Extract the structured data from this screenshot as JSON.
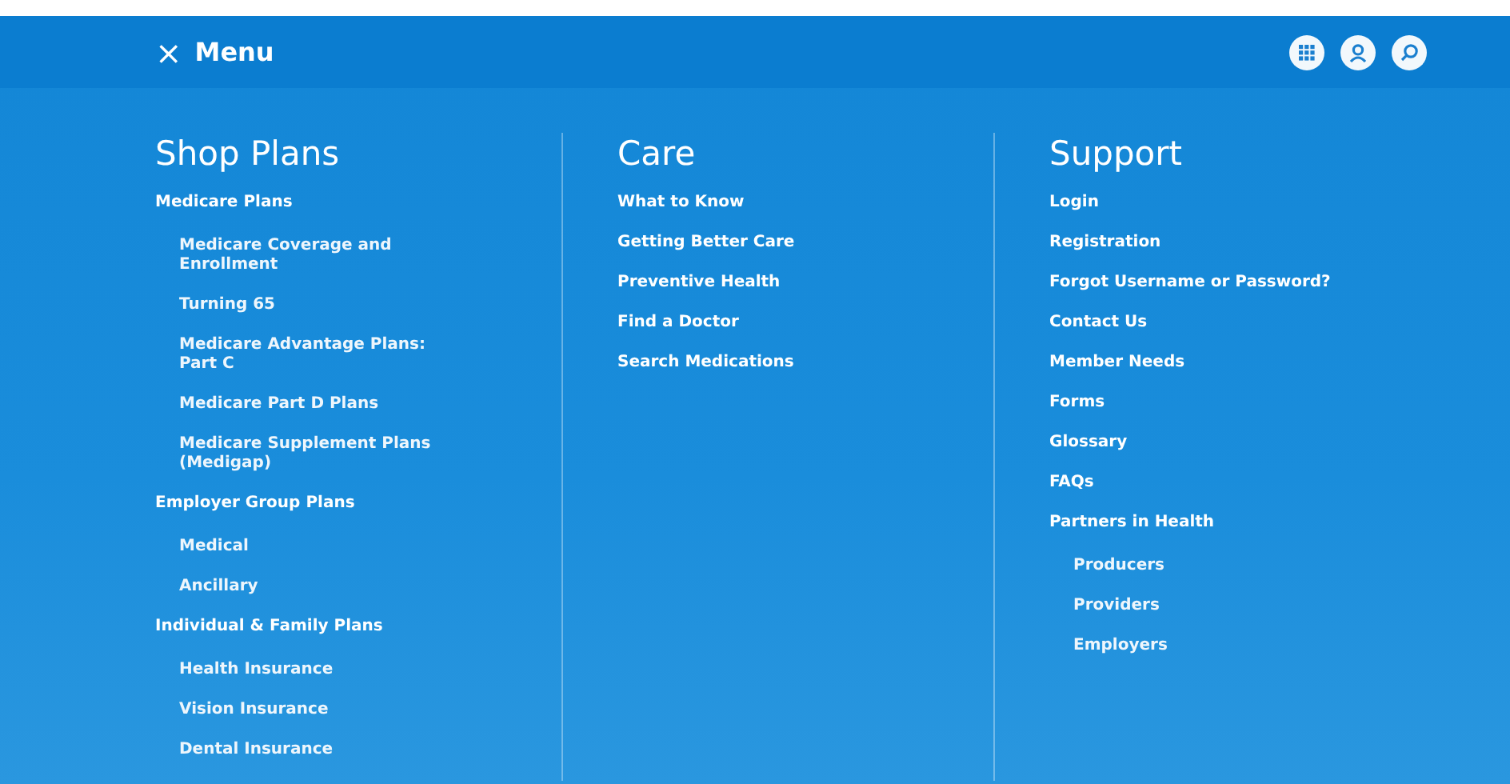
{
  "header": {
    "close_label": "×",
    "title": "Menu",
    "actions": [
      {
        "kind": "apps"
      },
      {
        "kind": "account"
      },
      {
        "kind": "search"
      }
    ]
  },
  "columns": [
    {
      "heading": "Shop Plans",
      "links": [
        {
          "label": "Medicare Plans",
          "children": [
            {
              "label": "Medicare Coverage and Enrollment"
            },
            {
              "label": "Turning 65"
            },
            {
              "label": "Medicare Advantage Plans: Part C"
            },
            {
              "label": "Medicare Part D Plans"
            },
            {
              "label": "Medicare Supplement Plans (Medigap)"
            }
          ]
        },
        {
          "label": "Employer Group Plans",
          "children": [
            {
              "label": "Medical"
            },
            {
              "label": "Ancillary"
            }
          ]
        },
        {
          "label": "Individual & Family Plans",
          "children": [
            {
              "label": "Health Insurance"
            },
            {
              "label": "Vision Insurance"
            },
            {
              "label": "Dental Insurance"
            }
          ]
        }
      ]
    },
    {
      "heading": "Care",
      "links": [
        {
          "label": "What to Know"
        },
        {
          "label": "Getting Better Care"
        },
        {
          "label": "Preventive Health"
        },
        {
          "label": "Find a Doctor"
        },
        {
          "label": "Search Medications"
        }
      ]
    },
    {
      "heading": "Support",
      "links": [
        {
          "label": "Login"
        },
        {
          "label": "Registration"
        },
        {
          "label": "Forgot Username or Password?"
        },
        {
          "label": "Contact Us"
        },
        {
          "label": "Member Needs"
        },
        {
          "label": "Forms"
        },
        {
          "label": "Glossary"
        },
        {
          "label": "FAQs"
        },
        {
          "label": "Partners in Health",
          "children": [
            {
              "label": "Producers"
            },
            {
              "label": "Providers"
            },
            {
              "label": "Employers"
            }
          ]
        }
      ]
    }
  ]
}
